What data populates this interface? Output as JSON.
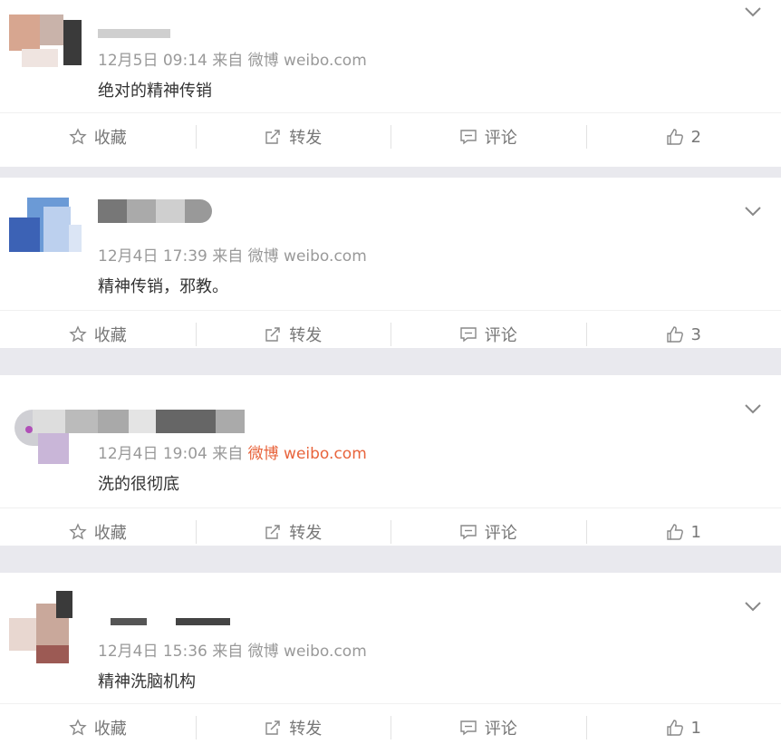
{
  "colors": {
    "background": "#e9e9ee",
    "card": "#ffffff",
    "meta_text": "#999999",
    "highlight": "#e8643c",
    "action_text": "#777777"
  },
  "actions": {
    "collect": "收藏",
    "repost": "转发",
    "comment": "评论"
  },
  "icons": {
    "collect": "star-outline-icon",
    "repost": "edit-share-icon",
    "comment": "comment-bubble-icon",
    "like": "thumbs-up-icon",
    "menu": "chevron-down-icon"
  },
  "comments": [
    {
      "meta": "12月5日 09:14 来自",
      "source": "微博 weibo.com",
      "source_highlighted": false,
      "text": "绝对的精神传销",
      "likes": "2"
    },
    {
      "meta": "12月4日 17:39 来自",
      "source": "微博 weibo.com",
      "source_highlighted": false,
      "text": "精神传销，邪教。",
      "likes": "3"
    },
    {
      "meta": "12月4日 19:04 来自",
      "source": "微博 weibo.com",
      "source_highlighted": true,
      "text": "洗的很彻底",
      "likes": "1"
    },
    {
      "meta": "12月4日 15:36 来自",
      "source": "微博 weibo.com",
      "source_highlighted": false,
      "text": "精神洗脑机构",
      "likes": "1"
    }
  ]
}
